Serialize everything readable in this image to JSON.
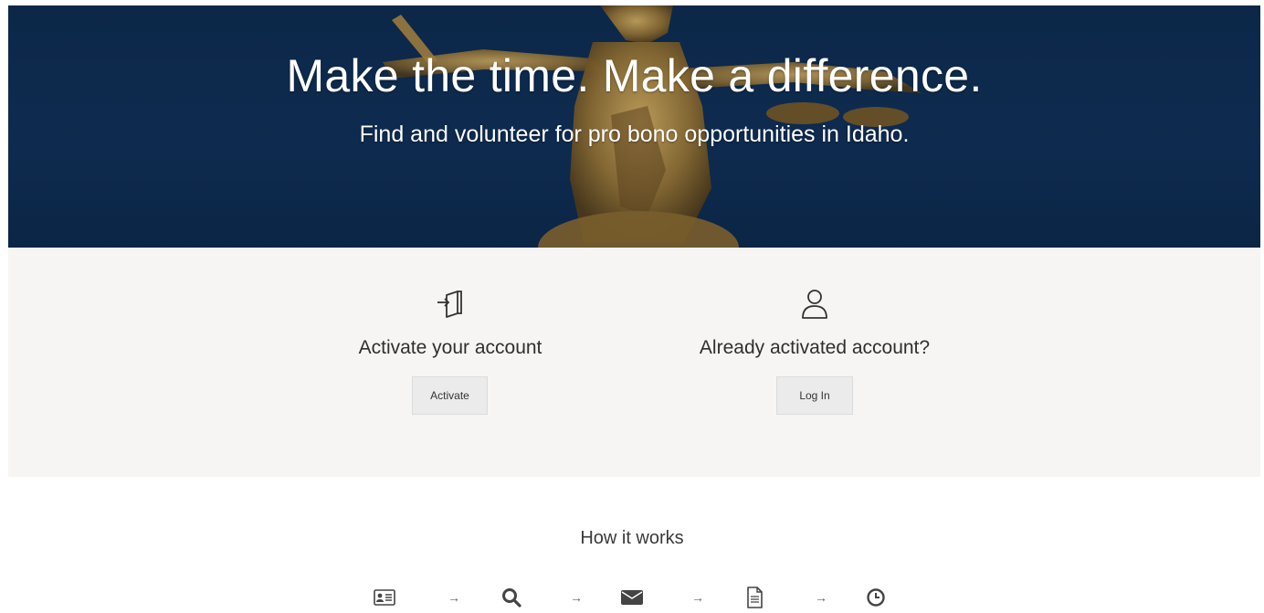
{
  "hero": {
    "title": "Make the time. Make a difference.",
    "subtitle": "Find and volunteer for pro bono opportunities in Idaho."
  },
  "account": {
    "activate": {
      "icon": "door-enter-icon",
      "label": "Activate your account",
      "button": "Activate"
    },
    "login": {
      "icon": "user-icon",
      "label": "Already activated account?",
      "button": "Log In"
    }
  },
  "how_it_works": {
    "title": "How it works",
    "steps": [
      {
        "icon": "id-card-icon"
      },
      {
        "icon": "search-icon"
      },
      {
        "icon": "envelope-icon"
      },
      {
        "icon": "document-icon"
      },
      {
        "icon": "clock-icon"
      }
    ],
    "arrow": "→"
  },
  "colors": {
    "hero_bg": "#0c2748",
    "band_bg": "#f6f5f3",
    "button_bg": "#ebebeb"
  }
}
